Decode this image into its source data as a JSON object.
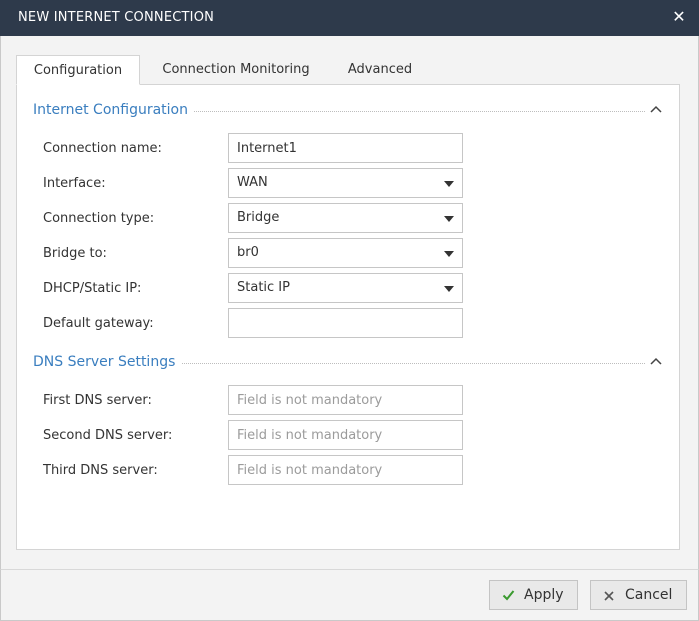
{
  "dialog": {
    "title": "NEW INTERNET CONNECTION",
    "close_glyph": "✕"
  },
  "tabs": [
    {
      "label": "Configuration",
      "active": true
    },
    {
      "label": "Connection Monitoring",
      "active": false
    },
    {
      "label": "Advanced",
      "active": false
    }
  ],
  "sections": {
    "internet": {
      "title": "Internet Configuration",
      "fields": [
        {
          "label": "Connection name:",
          "value": "Internet1",
          "kind": "text"
        },
        {
          "label": "Interface:",
          "value": "WAN",
          "kind": "select"
        },
        {
          "label": "Connection type:",
          "value": "Bridge",
          "kind": "select"
        },
        {
          "label": "Bridge to:",
          "value": "br0",
          "kind": "select"
        },
        {
          "label": "DHCP/Static IP:",
          "value": "Static IP",
          "kind": "select"
        },
        {
          "label": "Default gateway:",
          "value": "",
          "kind": "text"
        }
      ]
    },
    "dns": {
      "title": "DNS Server Settings",
      "fields": [
        {
          "label": "First DNS server:",
          "placeholder": "Field is not mandatory"
        },
        {
          "label": "Second DNS server:",
          "placeholder": "Field is not mandatory"
        },
        {
          "label": "Third DNS server:",
          "placeholder": "Field is not mandatory"
        }
      ]
    }
  },
  "footer": {
    "apply_label": "Apply",
    "cancel_label": "Cancel"
  },
  "colors": {
    "titlebar": "#2e3a4b",
    "section_title": "#3a7ebf",
    "apply_check": "#3a9a2f"
  }
}
